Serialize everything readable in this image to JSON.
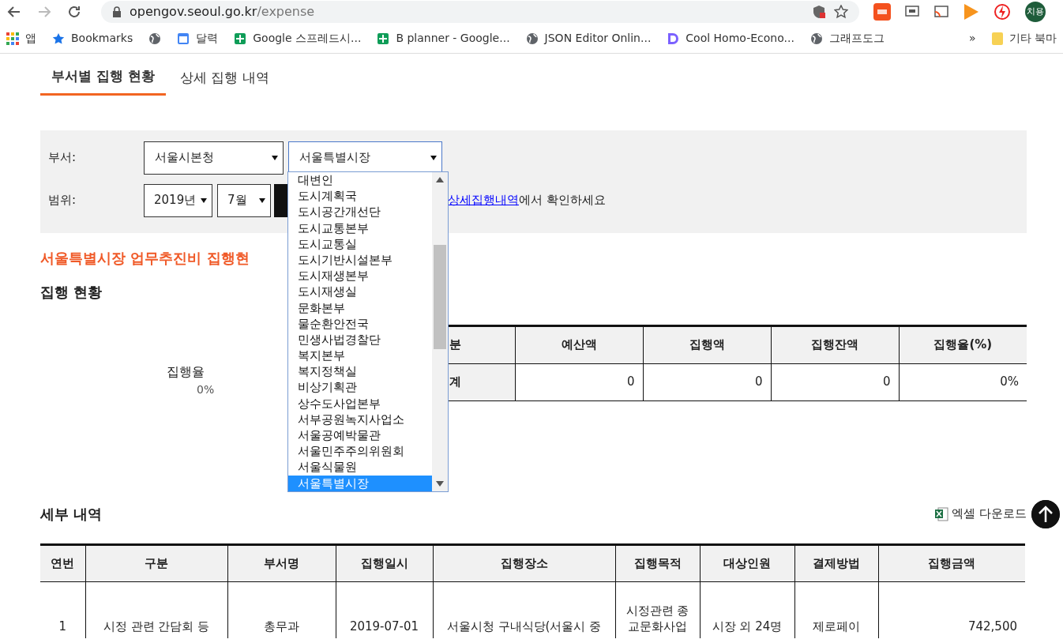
{
  "browser": {
    "url_host": "opengov.seoul.go.kr",
    "url_path": "/expense",
    "avatar": "치용",
    "bookmarks": [
      {
        "label": "앱",
        "kind": "apps"
      },
      {
        "label": "Bookmarks",
        "kind": "star"
      },
      {
        "kind": "globe"
      },
      {
        "label": "달력",
        "kind": "calendar"
      },
      {
        "label": "Google 스프레드시...",
        "kind": "sheet"
      },
      {
        "label": "B planner - Google...",
        "kind": "sheet"
      },
      {
        "label": "JSON Editor Onlin...",
        "kind": "globe"
      },
      {
        "label": "Cool Homo-Econo...",
        "kind": "doc"
      },
      {
        "label": "그래프도그",
        "kind": "globe"
      }
    ],
    "overflow": "»",
    "other_folder": "기타 북마"
  },
  "tabs": [
    {
      "label": "부서별 집행 현황",
      "selected": true
    },
    {
      "label": "상세 집행 내역",
      "selected": false
    }
  ],
  "filters": {
    "dept_label": "부서:",
    "dept_select_1": "서울시본청",
    "dept_select_2": "서울특별시장",
    "range_label": "범위:",
    "year": "2019년",
    "month": "7월",
    "hint_link": "상세집행내역",
    "hint_rest": "에서 확인하세요"
  },
  "dropdown": {
    "items": [
      {
        "label": "대변인",
        "selected": false
      },
      {
        "label": "도시계획국",
        "selected": false
      },
      {
        "label": "도시공간개선단",
        "selected": false
      },
      {
        "label": "도시교통본부",
        "selected": false
      },
      {
        "label": "도시교통실",
        "selected": false
      },
      {
        "label": "도시기반시설본부",
        "selected": false
      },
      {
        "label": "도시재생본부",
        "selected": false
      },
      {
        "label": "도시재생실",
        "selected": false
      },
      {
        "label": "문화본부",
        "selected": false
      },
      {
        "label": "물순환안전국",
        "selected": false
      },
      {
        "label": "민생사법경찰단",
        "selected": false
      },
      {
        "label": "복지본부",
        "selected": false
      },
      {
        "label": "복지정책실",
        "selected": false
      },
      {
        "label": "비상기획관",
        "selected": false
      },
      {
        "label": "상수도사업본부",
        "selected": false
      },
      {
        "label": "서부공원녹지사업소",
        "selected": false
      },
      {
        "label": "서울공예박물관",
        "selected": false
      },
      {
        "label": "서울민주주의위원회",
        "selected": false
      },
      {
        "label": "서울식물원",
        "selected": false
      },
      {
        "label": "서울특별시장",
        "selected": true
      }
    ]
  },
  "title": "서울특별시장 업무추진비 집행현",
  "summary": {
    "heading": "집행 현황",
    "rate_label": "집행율",
    "rate_value": "0%",
    "columns": [
      "분",
      "예산액",
      "집행액",
      "집행잔액",
      "집행율(%)"
    ],
    "rows": [
      [
        "계",
        "0",
        "0",
        "0",
        "0%"
      ]
    ]
  },
  "detail": {
    "heading": "세부 내역",
    "download": "엑셀 다운로드",
    "columns": [
      "연번",
      "구분",
      "부서명",
      "집행일시",
      "집행장소",
      "집행목적",
      "대상인원",
      "결제방법",
      "집행금액"
    ],
    "rows": [
      [
        [
          "1"
        ],
        [
          "시정 관련 간담회 등"
        ],
        [
          "총무과"
        ],
        [
          "2019-07-01"
        ],
        [
          "서울시청 구내식당(서울시 중"
        ],
        [
          "시정관련 종",
          "교문화사업"
        ],
        [
          "시장 외 24명"
        ],
        [
          "제로페이"
        ],
        [
          "742,500"
        ]
      ]
    ]
  }
}
